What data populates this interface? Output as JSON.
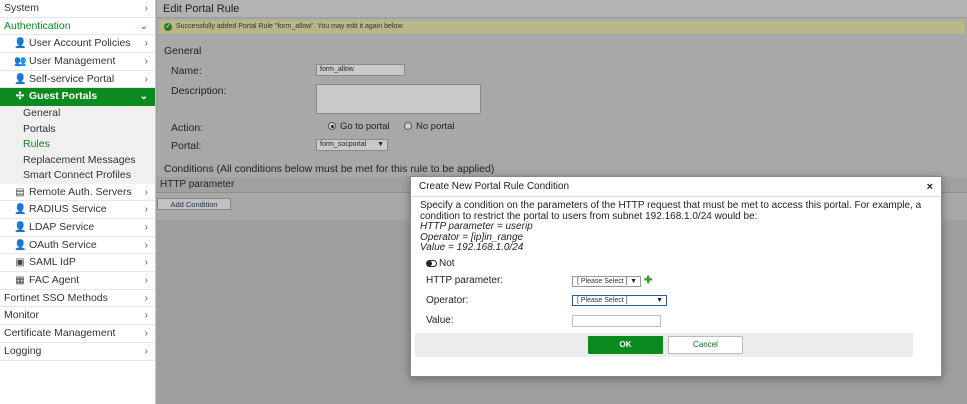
{
  "sidebar": {
    "items": [
      {
        "label": "System"
      },
      {
        "label": "Authentication"
      },
      {
        "label": "User Account Policies"
      },
      {
        "label": "User Management"
      },
      {
        "label": "Self-service Portal"
      },
      {
        "label": "Guest Portals"
      },
      {
        "label": "General"
      },
      {
        "label": "Portals"
      },
      {
        "label": "Rules"
      },
      {
        "label": "Replacement Messages"
      },
      {
        "label": "Smart Connect Profiles"
      },
      {
        "label": "Remote Auth. Servers"
      },
      {
        "label": "RADIUS Service"
      },
      {
        "label": "LDAP Service"
      },
      {
        "label": "OAuth Service"
      },
      {
        "label": "SAML IdP"
      },
      {
        "label": "FAC Agent"
      },
      {
        "label": "Fortinet SSO Methods"
      },
      {
        "label": "Monitor"
      },
      {
        "label": "Certificate Management"
      },
      {
        "label": "Logging"
      }
    ]
  },
  "main": {
    "title": "Edit Portal Rule",
    "notice": "Successfully added Portal Rule \"form_allow\". You may edit it again below.",
    "general_heading": "General",
    "name_label": "Name:",
    "name_value": "form_allow",
    "description_label": "Description:",
    "action_label": "Action:",
    "action_option_1": "Go to portal",
    "action_option_2": "No portal",
    "portal_label": "Portal:",
    "portal_value": "form_socportal",
    "conditions_heading": "Conditions (All conditions below must be met for this rule to be applied)",
    "http_parameter_col": "HTTP parameter",
    "add_condition": "Add Condition"
  },
  "modal": {
    "title": "Create New Portal Rule Condition",
    "close": "×",
    "desc_line1": "Specify a condition on the parameters of the HTTP request that must be met to access this portal. For example, a condition to restrict the portal to users from subnet 192.168.1.0/24 would be:",
    "example_1": "HTTP parameter = userip",
    "example_2": "Operator = [ip]in_range",
    "example_3": "Value = 192.168.1.0/24",
    "not_label": "Not",
    "http_param_label": "HTTP parameter:",
    "http_param_value": "[ Please Select ]",
    "operator_label": "Operator:",
    "operator_value": "[ Please Select ]",
    "value_label": "Value:",
    "ok": "OK",
    "cancel": "Cancel"
  },
  "colors": {
    "accent": "#0b8a1f",
    "overlay": "#9e9e9e"
  }
}
